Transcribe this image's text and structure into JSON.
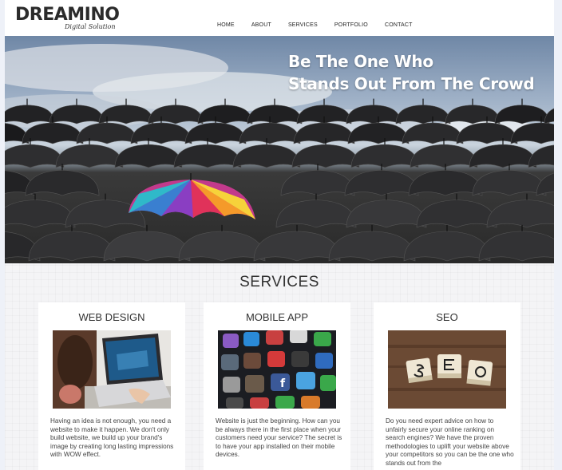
{
  "header": {
    "logo_main": "DREAMINO",
    "logo_sub": "Digital Solution",
    "nav": [
      "HOME",
      "ABOUT",
      "SERVICES",
      "PORTFOLIO",
      "CONTACT"
    ]
  },
  "hero": {
    "line1": "Be The One Who",
    "line2": "Stands Out From The Crowd"
  },
  "services": {
    "heading": "SERVICES",
    "cards": [
      {
        "title": "WEB DESIGN",
        "icon": "laptop-image",
        "text": "Having an idea is not enough, you need a website to make it happen. We don't only build website, we build up your brand's image by creating long lasting impressions with WOW effect."
      },
      {
        "title": "MOBILE APP",
        "icon": "app-icons-image",
        "text": "Website is just the beginning. How can you be always there in the first place when your customers need your service? The secret is to have your app installed on their mobile devices."
      },
      {
        "title": "SEO",
        "icon": "seo-tiles-image",
        "text": "Do you need expert advice on how to unfairly secure your online ranking on search engines? We have the proven methodologies to uplift your website above your competitors so you can be the one who stands out from the"
      }
    ]
  },
  "colors": {
    "header_bg": "#ffffff",
    "page_bg": "#f4f4f6",
    "umbrella_dark": "#2c2c2c",
    "hero_text": "#ffffff"
  }
}
